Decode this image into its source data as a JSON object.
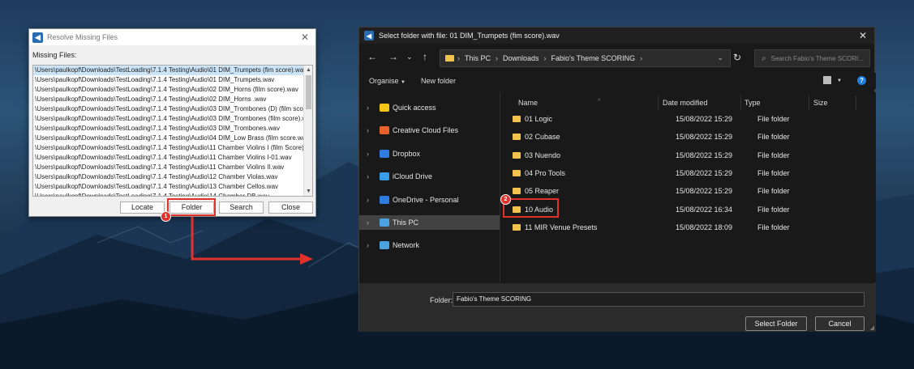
{
  "resolve_dialog": {
    "title": "Resolve Missing Files",
    "missing_label": "Missing Files:",
    "files": [
      "\\Users\\paulkopf\\Downloads\\TestLoading\\7.1.4 Testing\\Audio\\01 DIM_Trumpets (fim score).wav",
      "\\Users\\paulkopf\\Downloads\\TestLoading\\7.1.4 Testing\\Audio\\01 DIM_Trumpets.wav",
      "\\Users\\paulkopf\\Downloads\\TestLoading\\7.1.4 Testing\\Audio\\02 DIM_Horns (film score).wav",
      "\\Users\\paulkopf\\Downloads\\TestLoading\\7.1.4 Testing\\Audio\\02 DIM_Horns .wav",
      "\\Users\\paulkopf\\Downloads\\TestLoading\\7.1.4 Testing\\Audio\\03 DIM_Trombones (D) (film score",
      "\\Users\\paulkopf\\Downloads\\TestLoading\\7.1.4 Testing\\Audio\\03 DIM_Trombones (film score).wa",
      "\\Users\\paulkopf\\Downloads\\TestLoading\\7.1.4 Testing\\Audio\\03 DIM_Trombones.wav",
      "\\Users\\paulkopf\\Downloads\\TestLoading\\7.1.4 Testing\\Audio\\04 DIM_Low Brass (film score.wav",
      "\\Users\\paulkopf\\Downloads\\TestLoading\\7.1.4 Testing\\Audio\\11 Chamber Violins I (film Score).w",
      "\\Users\\paulkopf\\Downloads\\TestLoading\\7.1.4 Testing\\Audio\\11 Chamber Violins I-01.wav",
      "\\Users\\paulkopf\\Downloads\\TestLoading\\7.1.4 Testing\\Audio\\11 Chamber Violins II.wav",
      "\\Users\\paulkopf\\Downloads\\TestLoading\\7.1.4 Testing\\Audio\\12 Chamber Violas.wav",
      "\\Users\\paulkopf\\Downloads\\TestLoading\\7.1.4 Testing\\Audio\\13 Chamber Cellos.wav",
      "\\Users\\paulkopf\\Downloads\\TestLoading\\7.1.4 Testing\\Audio\\14 Chamber DB.wav"
    ],
    "buttons": {
      "locate": "Locate",
      "folder": "Folder",
      "search": "Search",
      "close": "Close"
    }
  },
  "folder_dialog": {
    "title": "Select folder with file: 01 DIM_Trumpets (fim score).wav",
    "breadcrumb": [
      "This PC",
      "Downloads",
      "Fabio's Theme SCORING"
    ],
    "search_placeholder": "Search Fabio's Theme SCORI...",
    "toolbar": {
      "organise": "Organise",
      "new_folder": "New folder"
    },
    "nav_items": [
      {
        "label": "Quick access",
        "icon": "star-icon",
        "color": "#f5c518"
      },
      {
        "label": "Creative Cloud Files",
        "icon": "creative-cloud-icon",
        "color": "#e8622c"
      },
      {
        "label": "Dropbox",
        "icon": "dropbox-icon",
        "color": "#2f7de1"
      },
      {
        "label": "iCloud Drive",
        "icon": "icloud-icon",
        "color": "#3a9be6"
      },
      {
        "label": "OneDrive - Personal",
        "icon": "onedrive-icon",
        "color": "#2f7de1"
      },
      {
        "label": "This PC",
        "icon": "pc-icon",
        "color": "#4aa3df",
        "selected": true
      },
      {
        "label": "Network",
        "icon": "network-icon",
        "color": "#4aa3df"
      }
    ],
    "columns": {
      "name": "Name",
      "date": "Date modified",
      "type": "Type",
      "size": "Size"
    },
    "rows": [
      {
        "name": "01 Logic",
        "date": "15/08/2022 15:29",
        "type": "File folder"
      },
      {
        "name": "02 Cubase",
        "date": "15/08/2022 15:29",
        "type": "File folder"
      },
      {
        "name": "03 Nuendo",
        "date": "15/08/2022 15:29",
        "type": "File folder"
      },
      {
        "name": "04 Pro Tools",
        "date": "15/08/2022 15:29",
        "type": "File folder"
      },
      {
        "name": "05 Reaper",
        "date": "15/08/2022 15:29",
        "type": "File folder"
      },
      {
        "name": "10 Audio",
        "date": "15/08/2022 16:34",
        "type": "File folder"
      },
      {
        "name": "11 MIR Venue Presets",
        "date": "15/08/2022 18:09",
        "type": "File folder"
      }
    ],
    "folder_label": "Folder:",
    "folder_value": "Fabio's Theme SCORING",
    "select_button": "Select Folder",
    "cancel_button": "Cancel"
  },
  "annotations": {
    "step1": "1",
    "step2": "2",
    "highlight_color": "#e0312b"
  }
}
